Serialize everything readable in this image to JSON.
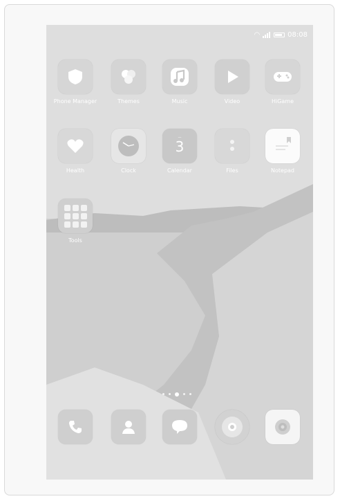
{
  "status_bar": {
    "time": "08:08"
  },
  "home": {
    "row1": [
      {
        "label": "Phone Manager",
        "icon": "shield-icon"
      },
      {
        "label": "Themes",
        "icon": "themes-icon"
      },
      {
        "label": "Music",
        "icon": "music-note-icon"
      },
      {
        "label": "Video",
        "icon": "play-icon"
      },
      {
        "label": "HiGame",
        "icon": "gamepad-icon"
      }
    ],
    "row2": [
      {
        "label": "Health",
        "icon": "heart-icon"
      },
      {
        "label": "Clock",
        "icon": "clock-icon"
      },
      {
        "label": "Calendar",
        "icon": "calendar-icon",
        "day": "3"
      },
      {
        "label": "Files",
        "icon": "files-icon"
      },
      {
        "label": "Notepad",
        "icon": "notepad-icon"
      }
    ],
    "row3": [
      {
        "label": "Tools",
        "icon": "folder-icon"
      }
    ],
    "pages": {
      "count": 5,
      "active": 3
    }
  },
  "dock": [
    {
      "name": "phone",
      "icon": "phone-icon"
    },
    {
      "name": "contacts",
      "icon": "contacts-icon"
    },
    {
      "name": "messages",
      "icon": "messages-icon"
    },
    {
      "name": "browser",
      "icon": "browser-icon"
    },
    {
      "name": "camera",
      "icon": "camera-icon"
    }
  ]
}
